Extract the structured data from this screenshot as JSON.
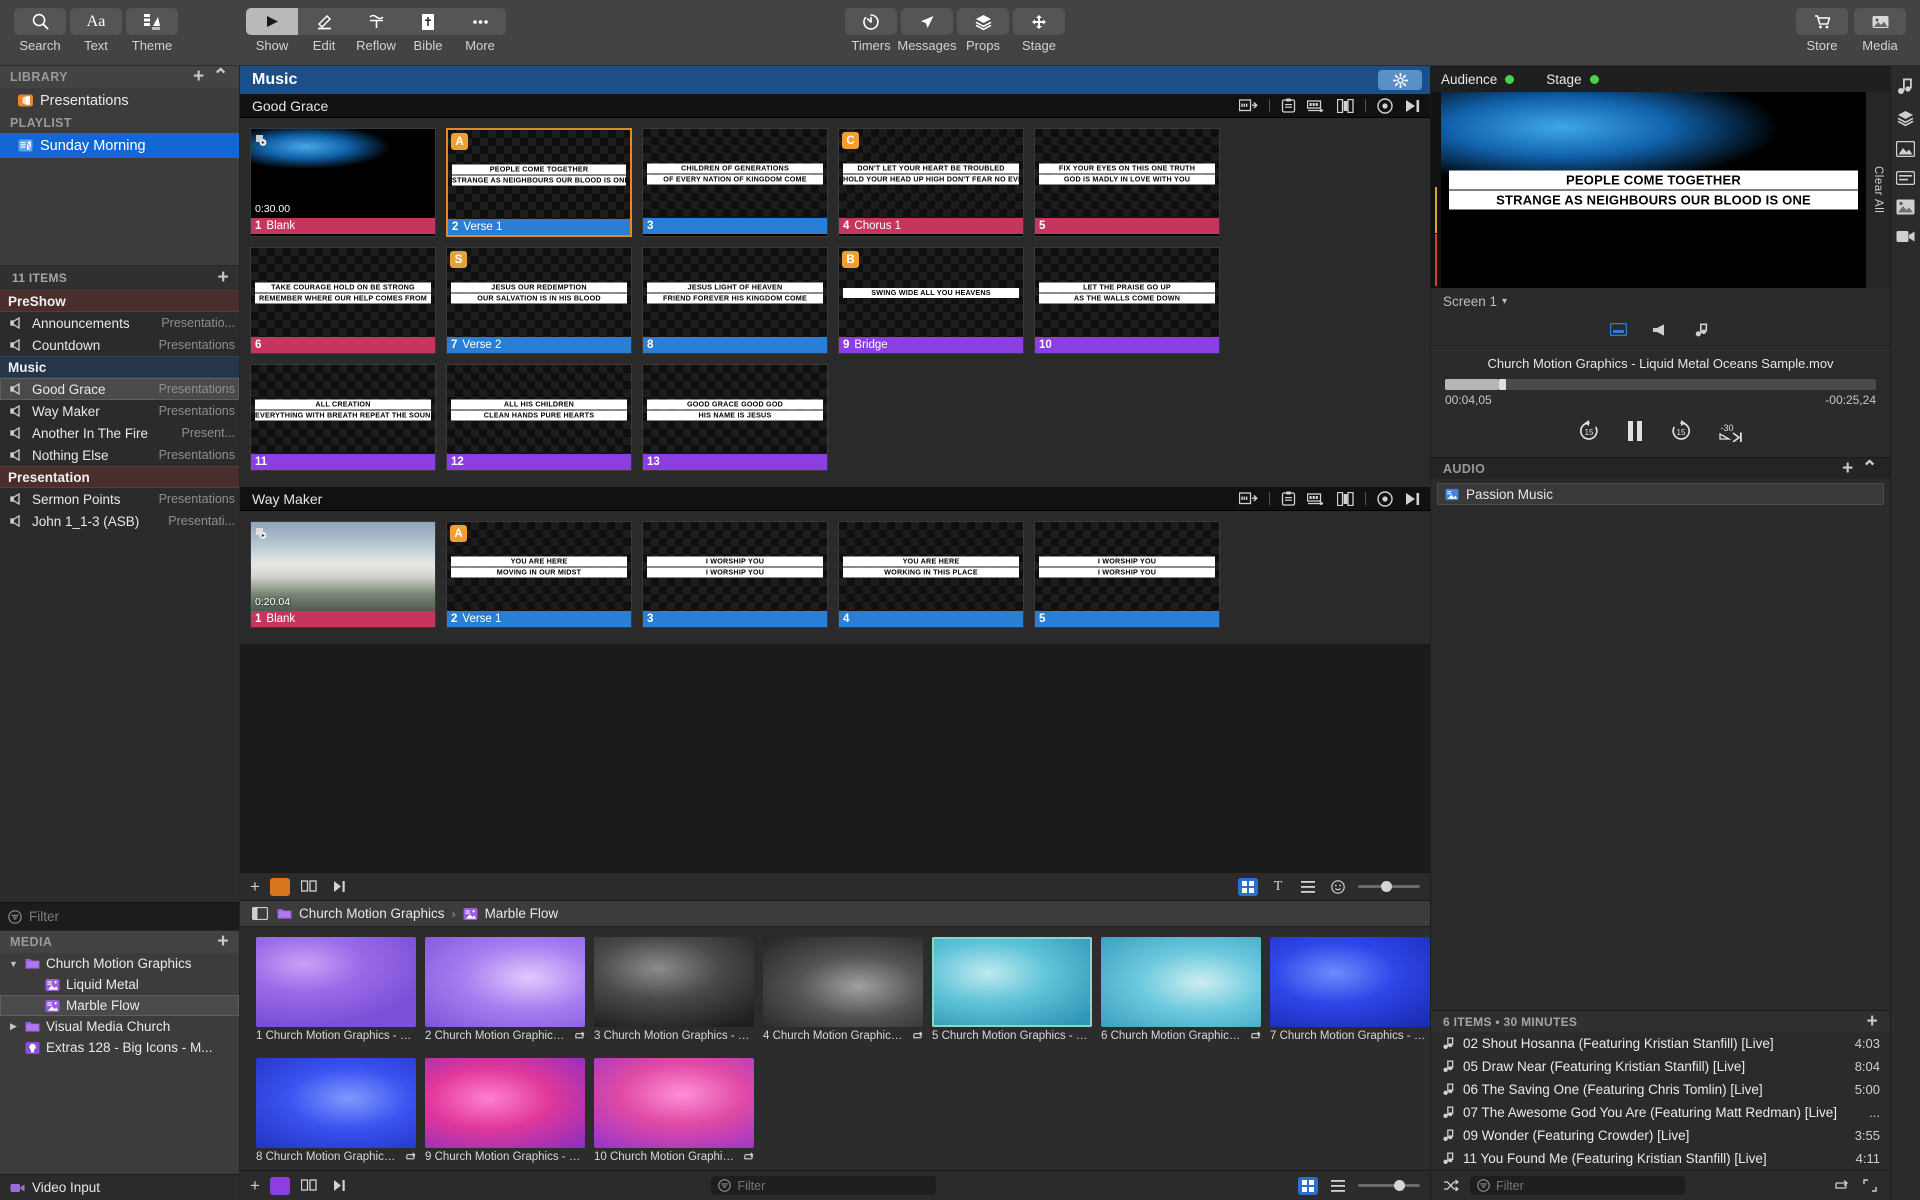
{
  "toolbar": {
    "left": [
      {
        "label": "Search",
        "icon": "search-icon"
      },
      {
        "label": "Text",
        "icon": "text-icon"
      },
      {
        "label": "Theme",
        "icon": "theme-icon"
      }
    ],
    "modes": [
      {
        "label": "Show",
        "icon": "play-icon",
        "active": true
      },
      {
        "label": "Edit",
        "icon": "pencil-icon",
        "active": false
      },
      {
        "label": "Reflow",
        "icon": "reflow-icon",
        "active": false
      },
      {
        "label": "Bible",
        "icon": "bible-icon",
        "active": false
      },
      {
        "label": "More",
        "icon": "ellipsis-icon",
        "active": false
      }
    ],
    "center": [
      {
        "label": "Timers",
        "icon": "timer-icon"
      },
      {
        "label": "Messages",
        "icon": "send-icon"
      },
      {
        "label": "Props",
        "icon": "layers-icon"
      },
      {
        "label": "Stage",
        "icon": "stage-icon"
      }
    ],
    "right": [
      {
        "label": "Store",
        "icon": "cart-icon"
      },
      {
        "label": "Media",
        "icon": "media-icon"
      }
    ]
  },
  "sidebar": {
    "library_header": "LIBRARY",
    "library_items": [
      {
        "label": "Presentations",
        "icon": "presentation-icon"
      }
    ],
    "playlist_header": "PLAYLIST",
    "playlist_items": [
      {
        "label": "Sunday Morning",
        "icon": "playlist-icon",
        "selected": true
      }
    ],
    "items_count": "11 ITEMS",
    "groups": [
      {
        "name": "PreShow",
        "color": "red",
        "docs": [
          {
            "name": "Announcements",
            "kind": "Presentatio..."
          },
          {
            "name": "Countdown",
            "kind": "Presentations"
          }
        ]
      },
      {
        "name": "Music",
        "color": "blue",
        "docs": [
          {
            "name": "Good Grace",
            "kind": "Presentations",
            "selected": true
          },
          {
            "name": "Way Maker",
            "kind": "Presentations"
          },
          {
            "name": "Another In The Fire",
            "kind": "Present..."
          },
          {
            "name": "Nothing Else",
            "kind": "Presentations"
          }
        ]
      },
      {
        "name": "Presentation",
        "color": "red",
        "docs": [
          {
            "name": "Sermon Points",
            "kind": "Presentations"
          },
          {
            "name": "John 1_1-3 (ASB)",
            "kind": "Presentati..."
          }
        ]
      }
    ],
    "filter_placeholder": "Filter",
    "media_header": "MEDIA",
    "media_tree": [
      {
        "label": "Church Motion Graphics",
        "icon": "folder-icon",
        "depth": 0,
        "expanded": true
      },
      {
        "label": "Liquid Metal",
        "icon": "media-playlist-icon",
        "depth": 1
      },
      {
        "label": "Marble Flow",
        "icon": "media-playlist-icon",
        "depth": 1,
        "selected": true
      },
      {
        "label": "Visual Media Church",
        "icon": "folder-icon",
        "depth": 0,
        "expanded": false
      },
      {
        "label": "Extras 128 - Big Icons - M...",
        "icon": "bulb-icon",
        "depth": 0
      }
    ],
    "video_input": {
      "label": "Video Input",
      "icon": "camera-icon"
    }
  },
  "center": {
    "playlist_title": "Music",
    "gear_icon": "gear-icon",
    "presentations": [
      {
        "title": "Good Grace",
        "header_icons": [
          "slide-advance-icon",
          "clipboard-icon",
          "timeline-icon",
          "arrange-icon",
          "record-icon",
          "next-icon"
        ],
        "slides": [
          {
            "num": "1",
            "name": "Blank",
            "label_color": "lbl-red",
            "kind": "media",
            "media": "blue-liquid",
            "duration": "0:30.00"
          },
          {
            "num": "2",
            "name": "Verse 1",
            "label_color": "lbl-blue",
            "badge": "A",
            "badge_class": "A",
            "selected": true,
            "lines": [
              "PEOPLE COME TOGETHER",
              "STRANGE AS NEIGHBOURS OUR BLOOD IS ONE"
            ]
          },
          {
            "num": "3",
            "name": "",
            "label_color": "lbl-blue",
            "lines": [
              "CHILDREN OF GENERATIONS",
              "OF EVERY NATION OF KINGDOM COME"
            ]
          },
          {
            "num": "4",
            "name": "Chorus 1",
            "label_color": "lbl-red",
            "badge": "C",
            "badge_class": "C",
            "lines": [
              "DON'T LET YOUR HEART BE TROUBLED",
              "HOLD YOUR HEAD UP HIGH DON'T FEAR NO EVIL"
            ]
          },
          {
            "num": "5",
            "name": "",
            "label_color": "lbl-red",
            "lines": [
              "FIX YOUR EYES ON THIS ONE TRUTH",
              "GOD IS MADLY IN LOVE WITH YOU"
            ]
          },
          {
            "num": "6",
            "name": "",
            "label_color": "lbl-red",
            "lines": [
              "TAKE COURAGE HOLD ON BE STRONG",
              "REMEMBER WHERE OUR HELP COMES FROM"
            ]
          },
          {
            "num": "7",
            "name": "Verse 2",
            "label_color": "lbl-blue",
            "badge": "S",
            "badge_class": "S",
            "lines": [
              "JESUS OUR REDEMPTION",
              "OUR SALVATION IS IN HIS BLOOD"
            ]
          },
          {
            "num": "8",
            "name": "",
            "label_color": "lbl-blue",
            "lines": [
              "JESUS LIGHT OF HEAVEN",
              "FRIEND FOREVER HIS KINGDOM COME"
            ]
          },
          {
            "num": "9",
            "name": "Bridge",
            "label_color": "lbl-purple",
            "badge": "B",
            "badge_class": "B",
            "lines": [
              "SWING WIDE ALL YOU HEAVENS"
            ]
          },
          {
            "num": "10",
            "name": "",
            "label_color": "lbl-purple",
            "lines": [
              "LET THE PRAISE GO UP",
              "AS THE WALLS COME DOWN"
            ]
          },
          {
            "num": "11",
            "name": "",
            "label_color": "lbl-purple",
            "lines": [
              "ALL CREATION",
              "EVERYTHING WITH BREATH REPEAT THE SOUND"
            ]
          },
          {
            "num": "12",
            "name": "",
            "label_color": "lbl-purple",
            "lines": [
              "ALL HIS CHILDREN",
              "CLEAN HANDS PURE HEARTS"
            ]
          },
          {
            "num": "13",
            "name": "",
            "label_color": "lbl-purple",
            "lines": [
              "GOOD GRACE GOOD GOD",
              "HIS NAME IS JESUS"
            ]
          }
        ]
      },
      {
        "title": "Way Maker",
        "header_icons": [
          "slide-advance-icon",
          "clipboard-icon",
          "timeline-icon",
          "arrange-icon",
          "record-icon",
          "next-icon"
        ],
        "slides": [
          {
            "num": "1",
            "name": "Blank",
            "label_color": "lbl-red",
            "kind": "media",
            "media": "mountain",
            "duration": "0:20.04"
          },
          {
            "num": "2",
            "name": "Verse 1",
            "label_color": "lbl-blue",
            "badge": "A",
            "badge_class": "A",
            "lines": [
              "YOU ARE HERE",
              "MOVING IN OUR MIDST"
            ]
          },
          {
            "num": "3",
            "name": "",
            "label_color": "lbl-blue",
            "lines": [
              "I WORSHIP YOU",
              "I WORSHIP YOU"
            ]
          },
          {
            "num": "4",
            "name": "",
            "label_color": "lbl-blue",
            "lines": [
              "YOU ARE HERE",
              "WORKING IN THIS PLACE"
            ]
          },
          {
            "num": "5",
            "name": "",
            "label_color": "lbl-blue",
            "lines": [
              "I WORSHIP YOU",
              "I WORSHIP YOU"
            ]
          }
        ]
      }
    ],
    "thumb_strip": {
      "add_icon": "plus-icon",
      "color_icon": "color-swatch-icon",
      "group_icon": "group-icon",
      "next_icon": "next-icon",
      "grid_icon": "grid-view-icon",
      "text_icon": "text-view-icon",
      "list_icon": "list-view-icon",
      "face_icon": "emoji-icon",
      "zoom_value": 45
    },
    "media_bin": {
      "sidebar_toggle_icon": "panel-toggle-icon",
      "breadcrumb": [
        {
          "label": "Church Motion Graphics",
          "icon": "folder-icon"
        },
        {
          "label": "Marble Flow",
          "icon": "media-playlist-icon"
        }
      ],
      "items": [
        {
          "n": "1",
          "label": "1 Church Motion Graphics - Ma...",
          "grad": "purple1",
          "loop": false
        },
        {
          "n": "2",
          "label": "2 Church Motion Graphics -...",
          "grad": "purple2",
          "loop": true
        },
        {
          "n": "3",
          "label": "3 Church Motion Graphics - Ma...",
          "grad": "gray1",
          "loop": false
        },
        {
          "n": "4",
          "label": "4 Church Motion Graphics -...",
          "grad": "gray2",
          "loop": true
        },
        {
          "n": "5",
          "label": "5 Church Motion Graphics - Ma...",
          "grad": "teal1",
          "loop": false,
          "selected": true
        },
        {
          "n": "6",
          "label": "6 Church Motion Graphics -...",
          "grad": "teal2",
          "loop": true
        },
        {
          "n": "7",
          "label": "7 Church Motion Graphics - Ma...",
          "grad": "blue1",
          "loop": false
        },
        {
          "n": "8",
          "label": "8 Church Motion Graphics -...",
          "grad": "blue2",
          "loop": true
        },
        {
          "n": "9",
          "label": "9 Church Motion Graphics - Ma...",
          "grad": "pink1",
          "loop": false
        },
        {
          "n": "10",
          "label": "10 Church Motion Graphics...",
          "grad": "pink2",
          "loop": true
        }
      ],
      "filter_placeholder": "Filter",
      "zoom_value": 70,
      "grid_icon": "grid-view-icon",
      "list_icon": "list-view-icon",
      "add_icon": "plus-icon"
    }
  },
  "right": {
    "audience_label": "Audience",
    "stage_label": "Stage",
    "audience_status_color": "#49d14a",
    "stage_status_color": "#49d14a",
    "clear_all": "Clear All",
    "preview_lines": [
      "PEOPLE COME TOGETHER",
      "STRANGE AS NEIGHBOURS OUR BLOOD IS ONE"
    ],
    "screen_selector": "Screen 1",
    "layer_icons": [
      "slide-layer-icon",
      "announcement-layer-icon",
      "audio-layer-icon"
    ],
    "media_name": "Church Motion Graphics - Liquid Metal Oceans Sample.mov",
    "time_elapsed": "00:04,05",
    "time_remaining": "-00:25,24",
    "transport": [
      {
        "icon": "rewind-15-icon",
        "label": "15"
      },
      {
        "icon": "pause-icon",
        "label": ""
      },
      {
        "icon": "forward-15-icon",
        "label": "15"
      },
      {
        "icon": "jump-30-icon",
        "label": "-30"
      }
    ],
    "audio_header": "AUDIO",
    "audio_add_icon": "plus-icon",
    "audio_collapse_icon": "chevron-up-icon",
    "audio_items": [
      {
        "label": "Passion Music",
        "icon": "audio-playlist-icon"
      }
    ],
    "playlist_count": "6 ITEMS • 30 MINUTES",
    "songs": [
      {
        "title": "02 Shout Hosanna (Featuring Kristian Stanfill) [Live]",
        "duration": "4:03"
      },
      {
        "title": "05 Draw Near (Featuring Kristian Stanfill) [Live]",
        "duration": "8:04"
      },
      {
        "title": "06 The Saving One (Featuring Chris Tomlin) [Live]",
        "duration": "5:00"
      },
      {
        "title": "07 The Awesome God You Are (Featuring Matt Redman) [Live]",
        "duration": "..."
      },
      {
        "title": "09 Wonder (Featuring Crowder) [Live]",
        "duration": "3:55"
      },
      {
        "title": "11 You Found Me (Featuring Kristian Stanfill) [Live]",
        "duration": "4:11"
      }
    ],
    "footer": {
      "shuffle_icon": "shuffle-icon",
      "filter_placeholder": "Filter",
      "repeat_icon": "repeat-icon",
      "expand_icon": "expand-icon"
    },
    "rail_icons": [
      "audio-rail-icon",
      "layers-rail-icon",
      "props-rail-icon",
      "messages-rail-icon",
      "image-rail-icon",
      "video-rail-icon"
    ]
  }
}
